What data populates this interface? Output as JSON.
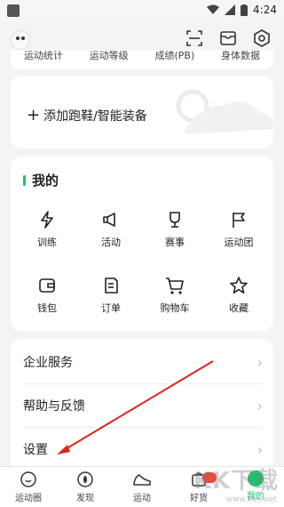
{
  "status": {
    "time": "4:24"
  },
  "stats_row": [
    "运动统计",
    "运动等级",
    "成绩(PB)",
    "身体数据"
  ],
  "shoe_card": {
    "plus": "+",
    "label": "添加跑鞋/智能装备"
  },
  "mine": {
    "title": "我的",
    "items": [
      {
        "label": "训练",
        "icon": "lightning-icon"
      },
      {
        "label": "活动",
        "icon": "megaphone-icon"
      },
      {
        "label": "赛事",
        "icon": "trophy-icon"
      },
      {
        "label": "运动团",
        "icon": "flag-icon"
      },
      {
        "label": "钱包",
        "icon": "wallet-icon"
      },
      {
        "label": "订单",
        "icon": "order-icon"
      },
      {
        "label": "购物车",
        "icon": "cart-icon"
      },
      {
        "label": "收藏",
        "icon": "star-icon"
      }
    ]
  },
  "list": [
    {
      "label": "企业服务"
    },
    {
      "label": "帮助与反馈"
    },
    {
      "label": "设置"
    }
  ],
  "tabs": [
    {
      "label": "运动圈"
    },
    {
      "label": "发现"
    },
    {
      "label": "运动"
    },
    {
      "label": "好货"
    },
    {
      "label": "我的"
    }
  ],
  "accent": "#1fc46a",
  "watermark": {
    "main": "KK下载",
    "sub": "www.kkx.net"
  }
}
